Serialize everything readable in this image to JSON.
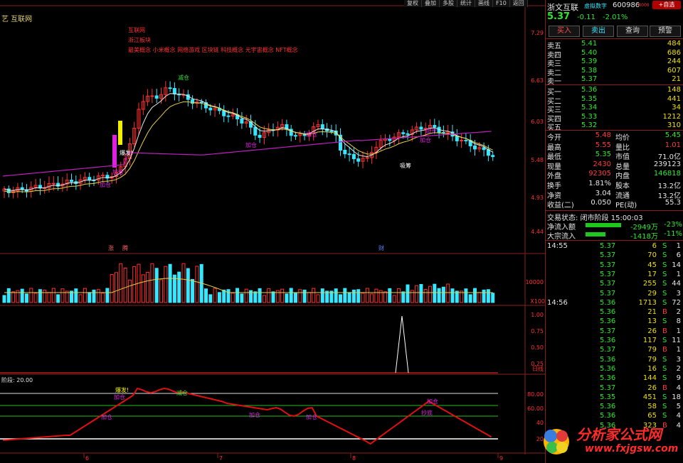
{
  "toolbar": [
    "复权",
    "叠加",
    "多股",
    "统计",
    "画线",
    "F10",
    "返回"
  ],
  "main_chart": {
    "title": "艺 互联网",
    "info_lines": [
      "互联网",
      "浙江板块",
      "最美概念 小米概念 网络游戏 区块链 科技概念 元宇宙概念 NFT概念"
    ],
    "price_ticks": [
      "7.29",
      "6.63",
      "6.03",
      "5.48",
      "4.93",
      "4.44"
    ],
    "event_labels": [
      "涨",
      "腾",
      "财"
    ],
    "annotations": [
      "爆发!",
      "加仓",
      "加仓",
      "减仓",
      "加仓",
      "加仓",
      "吸筹",
      "加仓",
      "加仓"
    ]
  },
  "volume_chart": {
    "tick": "10000",
    "unit": "X100"
  },
  "signal_chart": {
    "ticks": [
      "1.00",
      "0.75",
      "0.50",
      "0.25"
    ],
    "side": "日线"
  },
  "osc_chart": {
    "header": "阶段: 20.00",
    "ticks": [
      "80.00",
      "60.00",
      "40",
      "20"
    ],
    "annotations": [
      "爆发!",
      "加仓",
      "减仓",
      "加仓",
      "加仓",
      "加仓",
      "加仓",
      "抄底"
    ]
  },
  "date_ticks": [
    "6",
    "7",
    "8",
    "9"
  ],
  "watermark": {
    "name": "分析家公式网",
    "url": "www.fxjgsw.com"
  },
  "quote": {
    "name": "浙文互联",
    "tag": "虚拟数字",
    "code": "600986",
    "tag2": "R000",
    "ad": "+自选",
    "price": "5.37",
    "change": "-0.11",
    "pct": "-2.01%",
    "buttons": [
      "买入",
      "卖出",
      "查询",
      "预警"
    ],
    "asks": [
      {
        "label": "卖五",
        "price": "5.41",
        "vol": "484"
      },
      {
        "label": "卖四",
        "price": "5.40",
        "vol": "686"
      },
      {
        "label": "卖三",
        "price": "5.39",
        "vol": "244"
      },
      {
        "label": "卖二",
        "price": "5.38",
        "vol": "607"
      },
      {
        "label": "卖一",
        "price": "5.37",
        "vol": "21"
      }
    ],
    "bids": [
      {
        "label": "买一",
        "price": "5.36",
        "vol": "148"
      },
      {
        "label": "买二",
        "price": "5.35",
        "vol": "441"
      },
      {
        "label": "买三",
        "price": "5.34",
        "vol": "34"
      },
      {
        "label": "买四",
        "price": "5.33",
        "vol": "1212"
      },
      {
        "label": "买五",
        "price": "5.32",
        "vol": "310"
      }
    ],
    "stats": [
      {
        "l1": "今开",
        "v1": "5.48",
        "l2": "均价",
        "v2": "5.45",
        "c1": "red",
        "c2": "green"
      },
      {
        "l1": "最高",
        "v1": "5.55",
        "l2": "量比",
        "v2": "1.01",
        "c1": "red",
        "c2": "red"
      },
      {
        "l1": "最低",
        "v1": "5.35",
        "l2": "市值",
        "v2": "71.0亿",
        "c1": "green",
        "c2": "white"
      },
      {
        "l1": "现量",
        "v1": "2430",
        "l2": "总量",
        "v2": "239123",
        "c1": "red",
        "c2": "white"
      },
      {
        "l1": "外盘",
        "v1": "92305",
        "l2": "内盘",
        "v2": "146818",
        "c1": "red",
        "c2": "green"
      },
      {
        "l1": "换手",
        "v1": "1.81%",
        "l2": "股本",
        "v2": "13.2亿",
        "c1": "white",
        "c2": "white"
      },
      {
        "l1": "净资",
        "v1": "3.04",
        "l2": "流通",
        "v2": "13.2亿",
        "c1": "white",
        "c2": "white"
      },
      {
        "l1": "收益(二)",
        "v1": "0.050",
        "l2": "PE(动)",
        "v2": "55.3",
        "c1": "white",
        "c2": "white"
      }
    ],
    "status": "交易状态: 闭市阶段 15:00:03",
    "flows": [
      {
        "label": "净流入额",
        "value": "-2949万",
        "pct": "-23%"
      },
      {
        "label": "大宗流入",
        "value": "-1418万",
        "pct": "-11%"
      }
    ],
    "ticks": [
      {
        "time": "14:55",
        "price": "5.37",
        "vol": "6",
        "bs": "S",
        "n": "1"
      },
      {
        "time": "",
        "price": "5.37",
        "vol": "70",
        "bs": "S",
        "n": "6"
      },
      {
        "time": "",
        "price": "5.37",
        "vol": "45",
        "bs": "S",
        "n": "14"
      },
      {
        "time": "",
        "price": "5.37",
        "vol": "17",
        "bs": "S",
        "n": "1"
      },
      {
        "time": "",
        "price": "5.37",
        "vol": "255",
        "bs": "S",
        "n": "44"
      },
      {
        "time": "",
        "price": "5.37",
        "vol": "29",
        "bs": "S",
        "n": "3"
      },
      {
        "time": "14:56",
        "price": "5.36",
        "vol": "1713",
        "bs": "S",
        "n": "72"
      },
      {
        "time": "",
        "price": "5.36",
        "vol": "21",
        "bs": "B",
        "n": "2"
      },
      {
        "time": "",
        "price": "5.36",
        "vol": "13",
        "bs": "S",
        "n": "8"
      },
      {
        "time": "",
        "price": "5.37",
        "vol": "26",
        "bs": "B",
        "n": "1"
      },
      {
        "time": "",
        "price": "5.36",
        "vol": "117",
        "bs": "S",
        "n": "11"
      },
      {
        "time": "",
        "price": "5.37",
        "vol": "79",
        "bs": "B",
        "n": "1"
      },
      {
        "time": "",
        "price": "5.36",
        "vol": "79",
        "bs": "S",
        "n": "3"
      },
      {
        "time": "",
        "price": "5.36",
        "vol": "16",
        "bs": "S",
        "n": "2"
      },
      {
        "time": "",
        "price": "5.36",
        "vol": "144",
        "bs": "S",
        "n": "9"
      },
      {
        "time": "",
        "price": "5.37",
        "vol": "26",
        "bs": "B",
        "n": "4"
      },
      {
        "time": "",
        "price": "5.35",
        "vol": "451",
        "bs": "S",
        "n": "18"
      },
      {
        "time": "",
        "price": "5.36",
        "vol": "58",
        "bs": "S",
        "n": "5"
      },
      {
        "time": "",
        "price": "5.36",
        "vol": "65",
        "bs": "S",
        "n": "4"
      },
      {
        "time": "",
        "price": "5.36",
        "vol": "323",
        "bs": "B",
        "n": "4"
      }
    ]
  },
  "colors": {
    "up": "#ff3030",
    "down": "#35e7ff",
    "ma_white": "#e8e8e8",
    "ma_yellow": "#e8d24a",
    "ma_purple": "#c020c0",
    "osc": "#e01010"
  }
}
